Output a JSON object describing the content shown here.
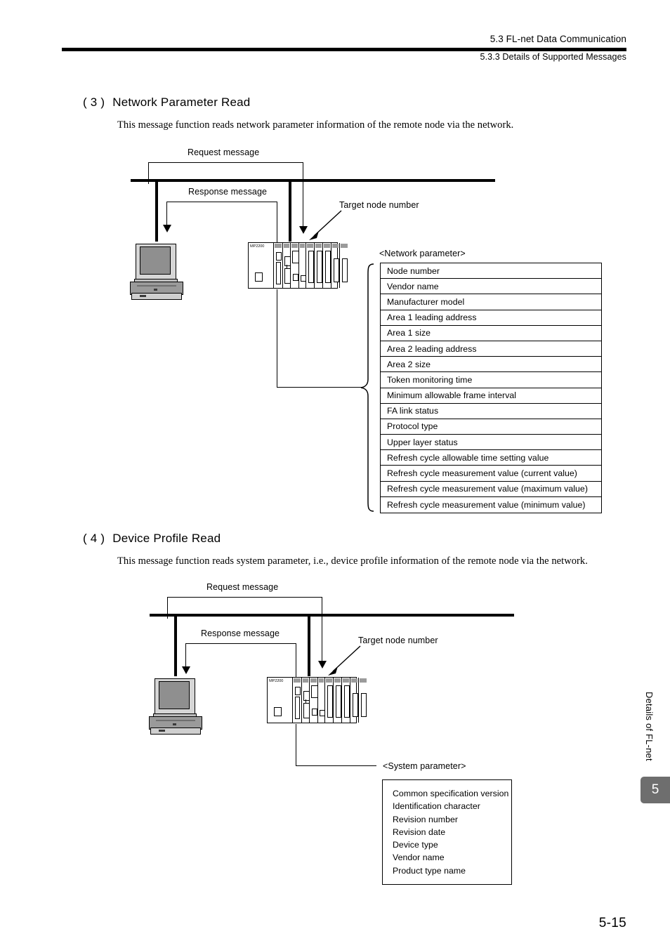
{
  "header": {
    "section": "5.3  FL-net Data Communication",
    "subsection": "5.3.3  Details of Supported Messages"
  },
  "sections": [
    {
      "number": "( 3 )",
      "title": "Network Parameter Read",
      "body": "This message function reads network parameter information of the remote node via the network.",
      "diagram": {
        "request_label": "Request message",
        "response_label": "Response message",
        "target_label": "Target node number",
        "device_name": "MP2200",
        "table_caption": "<Network parameter>",
        "table_rows": [
          "Node number",
          "Vendor name",
          "Manufacturer model",
          "Area 1 leading address",
          "Area 1 size",
          "Area 2 leading address",
          "Area 2 size",
          "Token monitoring time",
          "Minimum allowable  frame interval",
          "FA link status",
          "Protocol type",
          "Upper layer status",
          "Refresh cycle allowable time setting value",
          "Refresh cycle measurement value (current value)",
          "Refresh cycle measurement value (maximum value)",
          "Refresh cycle measurement value (minimum value)"
        ]
      }
    },
    {
      "number": "( 4 )",
      "title": "Device Profile Read",
      "body": "This message function reads system parameter, i.e., device profile information of the remote node via the network.",
      "diagram": {
        "request_label": "Request message",
        "response_label": "Response message",
        "target_label": "Target node number",
        "device_name": "MP2200",
        "table_caption": "<System parameter>",
        "table_rows": [
          "Common specification version",
          "Identification character",
          "Revision number",
          "Revision date",
          "Device type",
          "Vendor name",
          "Product type name"
        ]
      }
    }
  ],
  "side": {
    "chapter_text": "Details of FL-net",
    "chapter_number": "5"
  },
  "footer": {
    "page_number": "5-15"
  },
  "colors": {
    "ink": "#000000",
    "tab_gray": "#6e6e6e",
    "screen_gray": "#8f8f8f"
  }
}
